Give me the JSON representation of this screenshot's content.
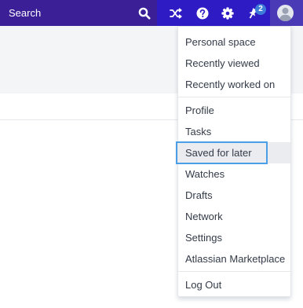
{
  "topbar": {
    "search_placeholder": "Search",
    "icons": [
      "search-icon",
      "shuffle-icon",
      "help-icon",
      "settings-gear-icon",
      "notification-pin-icon"
    ],
    "notification_count": "2",
    "colors": {
      "bar": "#2f1bc4",
      "search": "#3a1f97",
      "badge": "#3d7bd9",
      "focus": "#4a9fe6"
    }
  },
  "menu": {
    "group1": [
      "Personal space",
      "Recently viewed",
      "Recently worked on"
    ],
    "group2": [
      "Profile",
      "Tasks",
      "Saved for later",
      "Watches",
      "Drafts",
      "Network",
      "Settings",
      "Atlassian Marketplace"
    ],
    "group3": [
      "Log Out"
    ],
    "selected_item": "Saved for later"
  }
}
